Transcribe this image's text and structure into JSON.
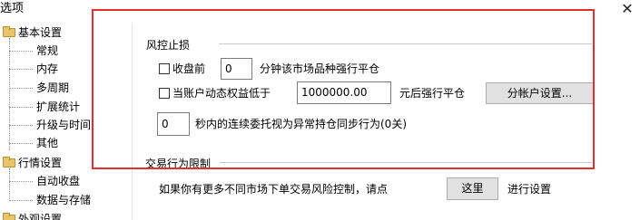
{
  "window": {
    "title": "选项",
    "close_glyph": "✕"
  },
  "tree": {
    "groups": [
      {
        "label": "基本设置",
        "children": [
          "常规",
          "内存",
          "多周期",
          "扩展统计",
          "升级与时间",
          "其他"
        ]
      },
      {
        "label": "行情设置",
        "children": [
          "自动收盘",
          "数据与存储"
        ]
      },
      {
        "label": "外观设置",
        "children": []
      }
    ]
  },
  "risk": {
    "group_title": "风控止损",
    "close_before": {
      "label": "收盘前",
      "value": "0",
      "suffix": "分钟该市场品种强行平仓"
    },
    "equity": {
      "label": "当账户动态权益低于",
      "value": "1000000.00",
      "suffix": "元后强行平仓",
      "button": "分帐户设置..."
    },
    "orders": {
      "value": "0",
      "suffix": "秒内的连续委托视为异常持仓同步行为(0关)"
    }
  },
  "trading": {
    "group_title": "交易行为限制",
    "hint": "如果你有更多不同市场下单交易风险控制，请点",
    "here_button": "这里",
    "after": "进行设置"
  },
  "highlight_color": "#e03030"
}
